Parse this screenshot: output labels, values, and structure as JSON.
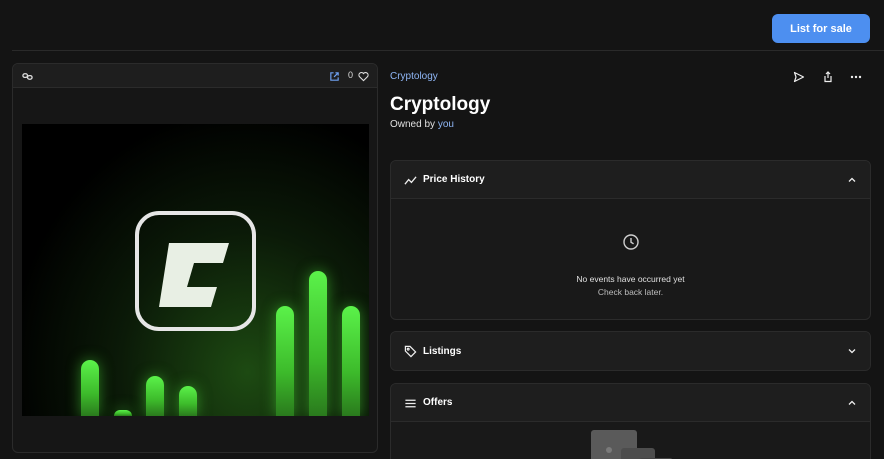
{
  "header": {
    "list_button": "List for sale"
  },
  "media": {
    "like_count": "0"
  },
  "item": {
    "collection": "Cryptology",
    "title": "Cryptology",
    "owned_prefix": "Owned by",
    "owner": "you"
  },
  "panels": {
    "price_history": {
      "title": "Price History",
      "empty_title": "No events have occurred yet",
      "empty_sub": "Check back later."
    },
    "listings": {
      "title": "Listings"
    },
    "offers": {
      "title": "Offers"
    }
  },
  "colors": {
    "accent": "#4d8ff0",
    "link": "#8fb6f5",
    "background": "#141414",
    "glow": "#5bf24a"
  },
  "icons": [
    "chain-icon",
    "external-link-icon",
    "heart-icon",
    "send-icon",
    "share-icon",
    "more-icon",
    "trend-icon",
    "tag-icon",
    "list-icon",
    "chevron-up-icon",
    "chevron-down-icon",
    "clock-icon"
  ]
}
